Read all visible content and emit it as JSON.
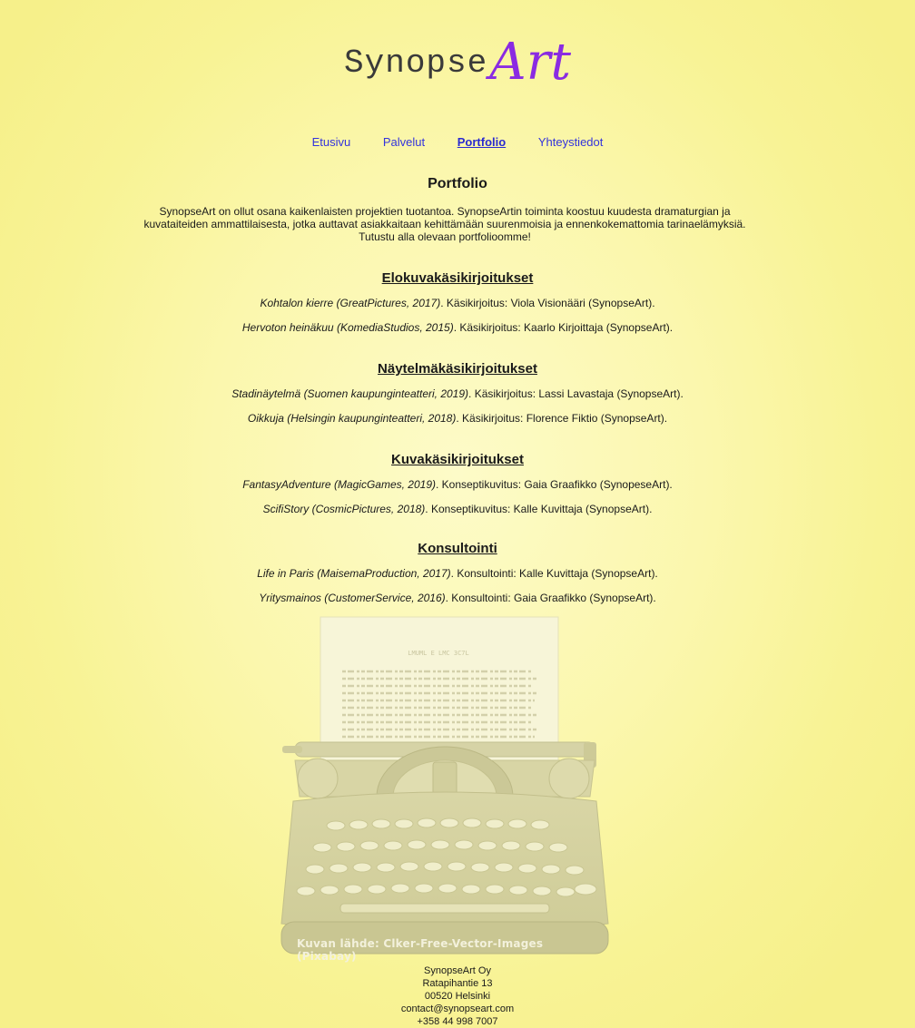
{
  "logo": {
    "text_main": "Synopse",
    "text_accent": "Art",
    "accent_color": "#8a2be2"
  },
  "nav": {
    "items": [
      {
        "label": "Etusivu",
        "active": false
      },
      {
        "label": "Palvelut",
        "active": false
      },
      {
        "label": "Portfolio",
        "active": true
      },
      {
        "label": "Yhteystiedot",
        "active": false
      }
    ],
    "link_color": "#3333dd"
  },
  "page": {
    "title": "Portfolio",
    "intro": "SynopseArt on ollut osana kaikenlaisten projektien tuotantoa. SynopseArtin toiminta koostuu kuudesta dramaturgian ja kuvataiteiden ammattilaisesta, jotka auttavat asiakkaitaan kehittämään suurenmoisia ja ennenkokemattomia tarinaelämyksiä. Tutustu alla olevaan portfolioomme!"
  },
  "sections": [
    {
      "heading": "Elokuvakäsikirjoitukset",
      "entries": [
        {
          "work": "Kohtalon kierre (GreatPictures, 2017)",
          "credit": ". Käsikirjoitus: Viola Visionääri (SynopseArt)."
        },
        {
          "work": "Hervoton heinäkuu (KomediaStudios, 2015)",
          "credit": ". Käsikirjoitus: Kaarlo Kirjoittaja (SynopseArt)."
        }
      ]
    },
    {
      "heading": "Näytelmäkäsikirjoitukset",
      "entries": [
        {
          "work": "Stadinäytelmä (Suomen kaupunginteatteri, 2019)",
          "credit": ". Käsikirjoitus: Lassi Lavastaja (SynopseArt)."
        },
        {
          "work": "Oikkuja (Helsingin kaupunginteatteri, 2018)",
          "credit": ". Käsikirjoitus: Florence Fiktio (SynopseArt)."
        }
      ]
    },
    {
      "heading": "Kuvakäsikirjoitukset",
      "entries": [
        {
          "work": "FantasyAdventure (MagicGames, 2019)",
          "credit": ". Konseptikuvitus: Gaia Graafikko (SynopeseArt)."
        },
        {
          "work": "ScifiStory (CosmicPictures, 2018)",
          "credit": ". Konseptikuvitus: Kalle Kuvittaja (SynopseArt)."
        }
      ]
    },
    {
      "heading": "Konsultointi",
      "entries": [
        {
          "work": "Life in Paris (MaisemaProduction, 2017)",
          "credit": ". Konsultointi: Kalle Kuvittaja (SynopseArt)."
        },
        {
          "work": "Yritysmainos (CustomerService, 2016)",
          "credit": ". Konsultointi: Gaia Graafikko (SynopseArt)."
        }
      ]
    }
  ],
  "image": {
    "subject": "typewriter-illustration",
    "credit": "Kuvan lähde: Clker-Free-Vector-Images (Pixabay)",
    "paper_title": "LMUML E LMC 3C7L"
  },
  "footer": {
    "company": "SynopseArt Oy",
    "street": "Ratapihantie 13",
    "city": "00520 Helsinki",
    "email": "contact@synopseart.com",
    "phone": "+358 44 998 7007"
  }
}
